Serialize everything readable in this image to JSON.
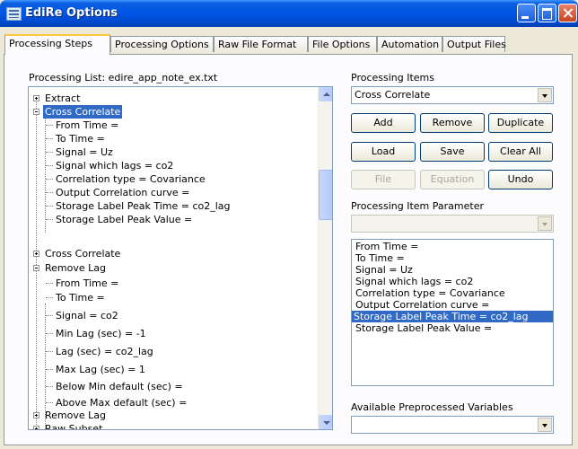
{
  "window": {
    "title": "EdiRe Options"
  },
  "tabs": [
    {
      "label": "Processing Steps",
      "active": true
    },
    {
      "label": "Processing Options"
    },
    {
      "label": "Raw File Format"
    },
    {
      "label": "File Options"
    },
    {
      "label": "Automation"
    },
    {
      "label": "Output Files"
    }
  ],
  "processing_list": {
    "label": "Processing List: edire_app_note_ex.txt",
    "items": [
      {
        "text": "Extract",
        "level": 0,
        "expander": "plus"
      },
      {
        "text": "Cross Correlate",
        "level": 0,
        "expander": "minus",
        "selected": true
      },
      {
        "text": "From Time =",
        "level": 1
      },
      {
        "text": "To Time =",
        "level": 1
      },
      {
        "text": "Signal = Uz",
        "level": 1
      },
      {
        "text": "Signal which lags = co2",
        "level": 1
      },
      {
        "text": "Correlation type =  Covariance",
        "level": 1
      },
      {
        "text": "Output Correlation curve =",
        "level": 1
      },
      {
        "text": "Storage Label Peak Time = co2_lag",
        "level": 1
      },
      {
        "text": "Storage Label Peak Value =",
        "level": 1
      },
      {
        "text": "Cross Correlate",
        "level": 0,
        "expander": "plus"
      },
      {
        "text": "Remove Lag",
        "level": 0,
        "expander": "minus"
      },
      {
        "text": "From Time =",
        "level": 1
      },
      {
        "text": "To Time =",
        "level": 1
      },
      {
        "text": "Signal = co2",
        "level": 1
      },
      {
        "text": "Min Lag (sec) = -1",
        "level": 1
      },
      {
        "text": "Lag (sec) = co2_lag",
        "level": 1
      },
      {
        "text": "Max Lag (sec) = 1",
        "level": 1
      },
      {
        "text": "Below Min default (sec) =",
        "level": 1
      },
      {
        "text": "Above Max default (sec) =",
        "level": 1
      },
      {
        "text": "Remove Lag",
        "level": 0,
        "expander": "plus"
      },
      {
        "text": "Raw Subset",
        "level": 0,
        "expander": "plus"
      }
    ]
  },
  "processing_items": {
    "label": "Processing Items",
    "value": "Cross Correlate"
  },
  "buttons": {
    "add": "Add",
    "remove": "Remove",
    "duplicate": "Duplicate",
    "load": "Load",
    "save": "Save",
    "clear_all": "Clear All",
    "file": "File",
    "equation": "Equation",
    "undo": "Undo"
  },
  "processing_item_parameter": {
    "label": "Processing Item Parameter",
    "value": "",
    "items": [
      {
        "text": "From Time ="
      },
      {
        "text": "To Time ="
      },
      {
        "text": "Signal = Uz"
      },
      {
        "text": "Signal which lags = co2"
      },
      {
        "text": "Correlation type =  Covariance"
      },
      {
        "text": "Output Correlation curve ="
      },
      {
        "text": "Storage Label Peak Time = co2_lag",
        "selected": true
      },
      {
        "text": "Storage Label Peak Value ="
      }
    ]
  },
  "available_preprocessed": {
    "label": "Available Preprocessed Variables",
    "value": ""
  },
  "colors": {
    "title_bar": "#0055e5",
    "selection": "#316ac5",
    "tab_highlight": "#ffc83c"
  }
}
